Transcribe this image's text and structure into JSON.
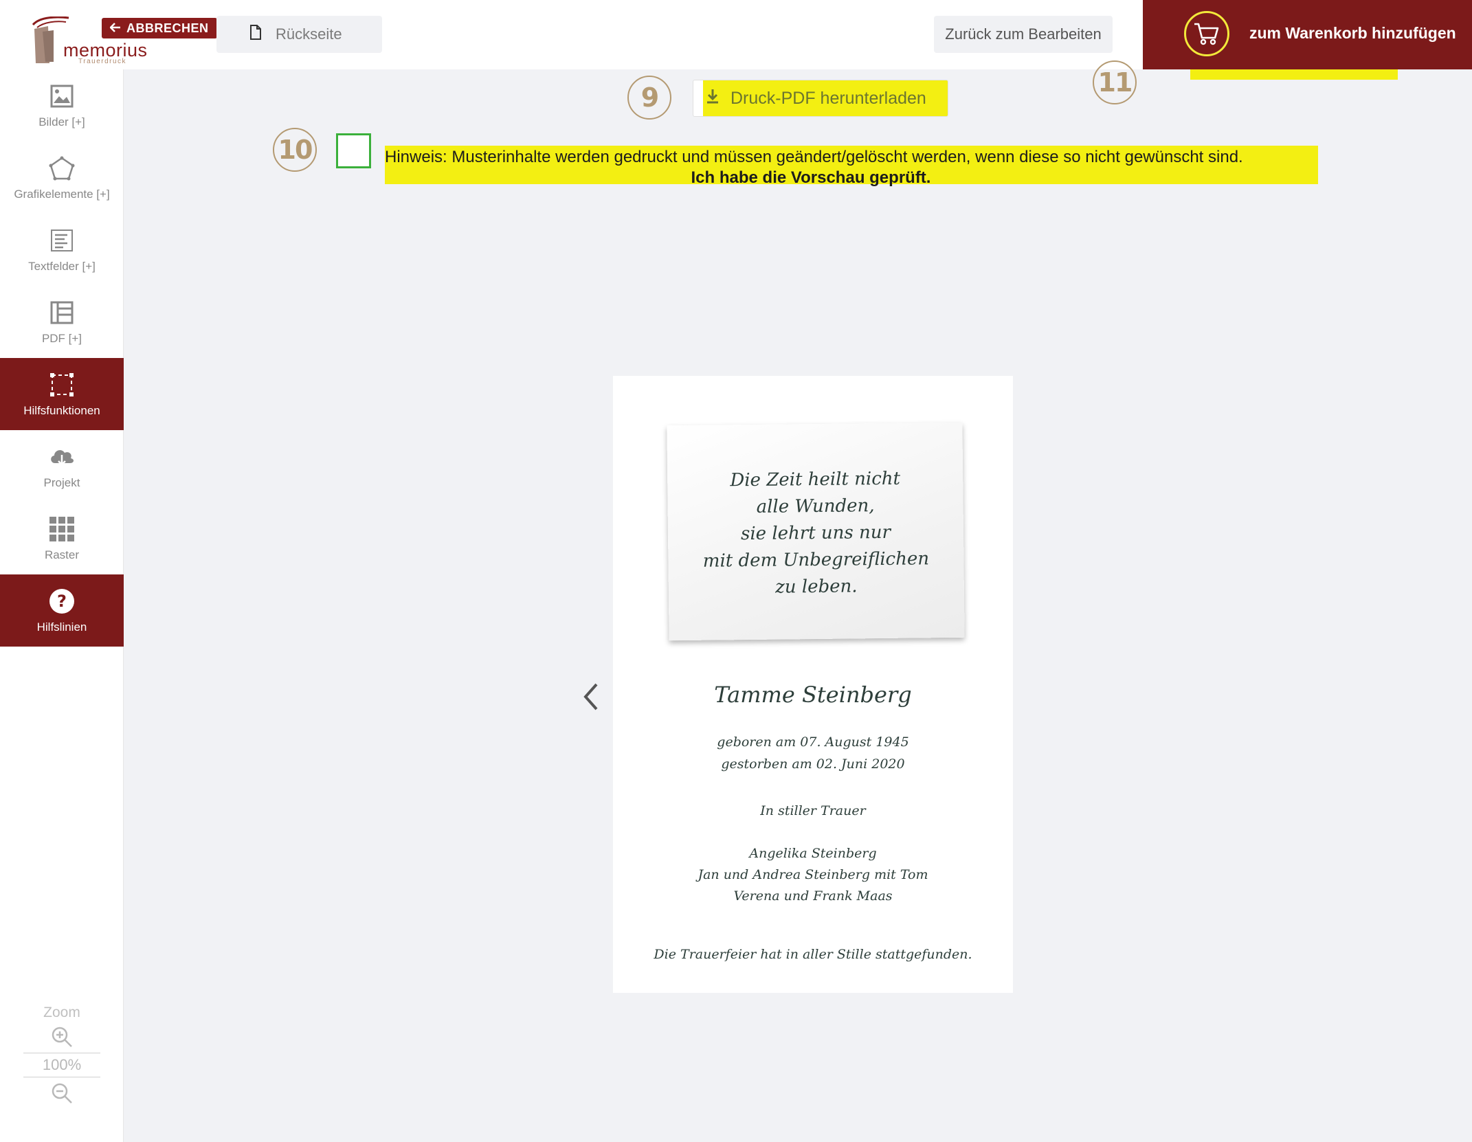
{
  "header": {
    "cancel_label": "ABBRECHEN",
    "logo_name": "memorius",
    "logo_sub": "Trauerdruck",
    "back_page_label": "Rückseite",
    "edit_label": "Zurück zum Bearbeiten",
    "cart_label": "zum Warenkorb hinzufügen"
  },
  "sidebar": {
    "items": [
      {
        "label": "Bilder [+]",
        "icon": "image-icon"
      },
      {
        "label": "Grafikelemente [+]",
        "icon": "pentagon-icon"
      },
      {
        "label": "Textfelder [+]",
        "icon": "textfield-icon"
      },
      {
        "label": "PDF [+]",
        "icon": "pdf-layout-icon"
      },
      {
        "label": "Hilfsfunktionen",
        "icon": "selection-frame-icon",
        "active": true
      },
      {
        "label": "Projekt",
        "icon": "cloud-download-icon"
      },
      {
        "label": "Raster",
        "icon": "grid-icon"
      },
      {
        "label": "Hilfslinien",
        "icon": "question-icon",
        "active": true
      }
    ],
    "zoom_label": "Zoom",
    "zoom_value": "100%"
  },
  "badges": {
    "b9": "9",
    "b10": "10",
    "b11": "11"
  },
  "pdf_download_label": "Druck-PDF herunterladen",
  "notice": {
    "line1": "Hinweis: Musterinhalte werden gedruckt und müssen geändert/gelöscht werden, wenn diese so nicht gewünscht sind.",
    "line2": "Ich habe die Vorschau geprüft."
  },
  "card": {
    "quote": [
      "Die Zeit heilt nicht",
      "alle Wunden,",
      "sie lehrt uns nur",
      "mit dem Unbegreiflichen",
      "zu leben."
    ],
    "name": "Tamme Steinberg",
    "born": "geboren am 07. August 1945",
    "died": "gestorben am 02. Juni 2020",
    "mourning": "In stiller Trauer",
    "mourners": [
      "Angelika Steinberg",
      "Jan und Andrea Steinberg mit Tom",
      "Verena und Frank Maas"
    ],
    "footer": "Die Trauerfeier hat in aller Stille stattgefunden."
  },
  "colors": {
    "brand": "#7c1a1a",
    "highlight": "#f3ef12",
    "badge": "#b49a72",
    "checkbox_border": "#3bb03b"
  }
}
